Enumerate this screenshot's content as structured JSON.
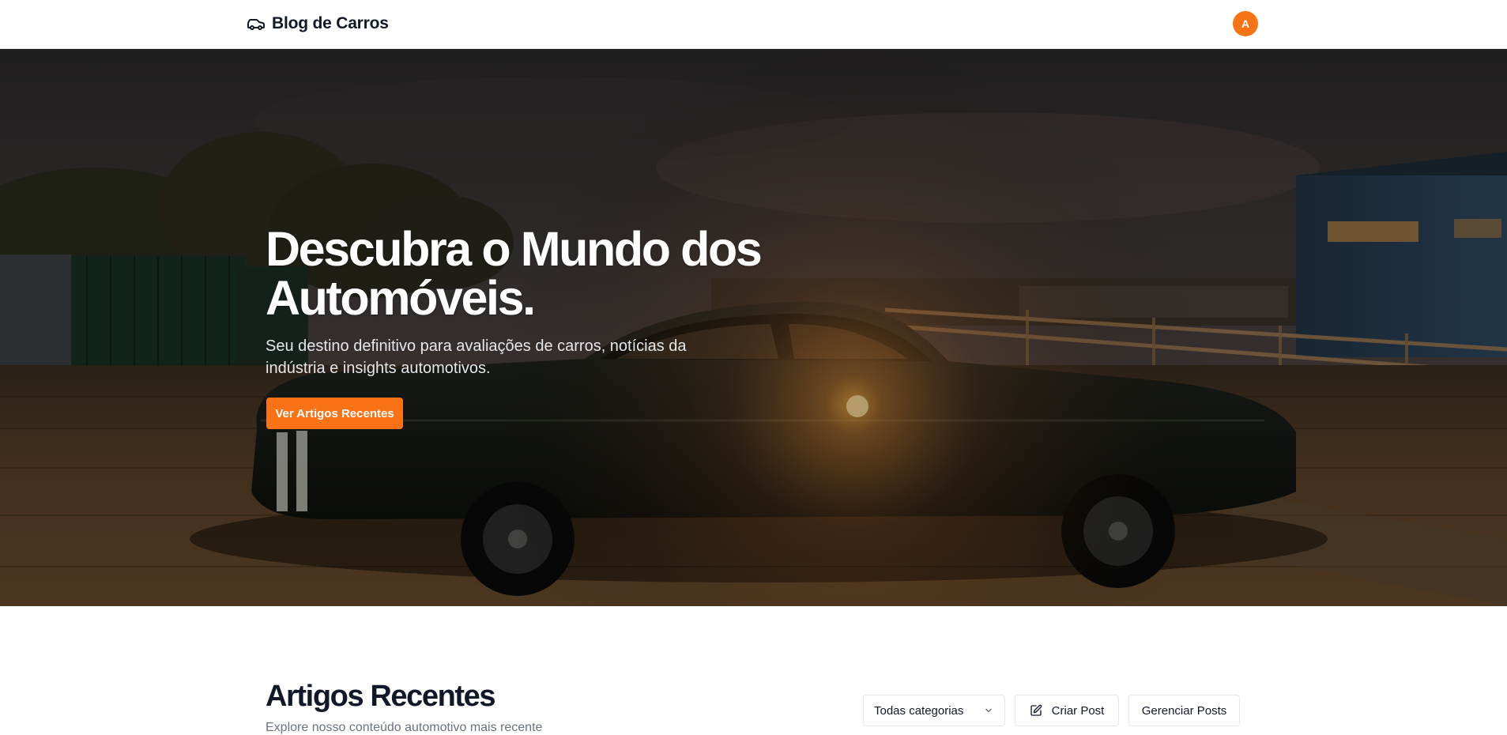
{
  "header": {
    "brand_icon": "car-icon",
    "brand_name": "Blog de Carros",
    "avatar_initial": "A",
    "accent_color": "#f97316"
  },
  "hero": {
    "background": "classic-muscle-car-at-sunset-photo",
    "title_line1": "Descubra o Mundo dos",
    "title_line2": "Automóveis.",
    "subtitle_line1": "Seu destino definitivo para avaliações de carros, notícias da",
    "subtitle_line2": "indústria e insights automotivos.",
    "cta_label": "Ver Artigos Recentes"
  },
  "articles": {
    "title": "Artigos Recentes",
    "subtitle": "Explore nosso conteúdo automotivo mais recente",
    "category_selected": "Todas categorias",
    "category_icon": "chevron-down-icon",
    "create_icon": "pencil-square-icon",
    "create_label": "Criar Post",
    "manage_label": "Gerenciar Posts"
  }
}
